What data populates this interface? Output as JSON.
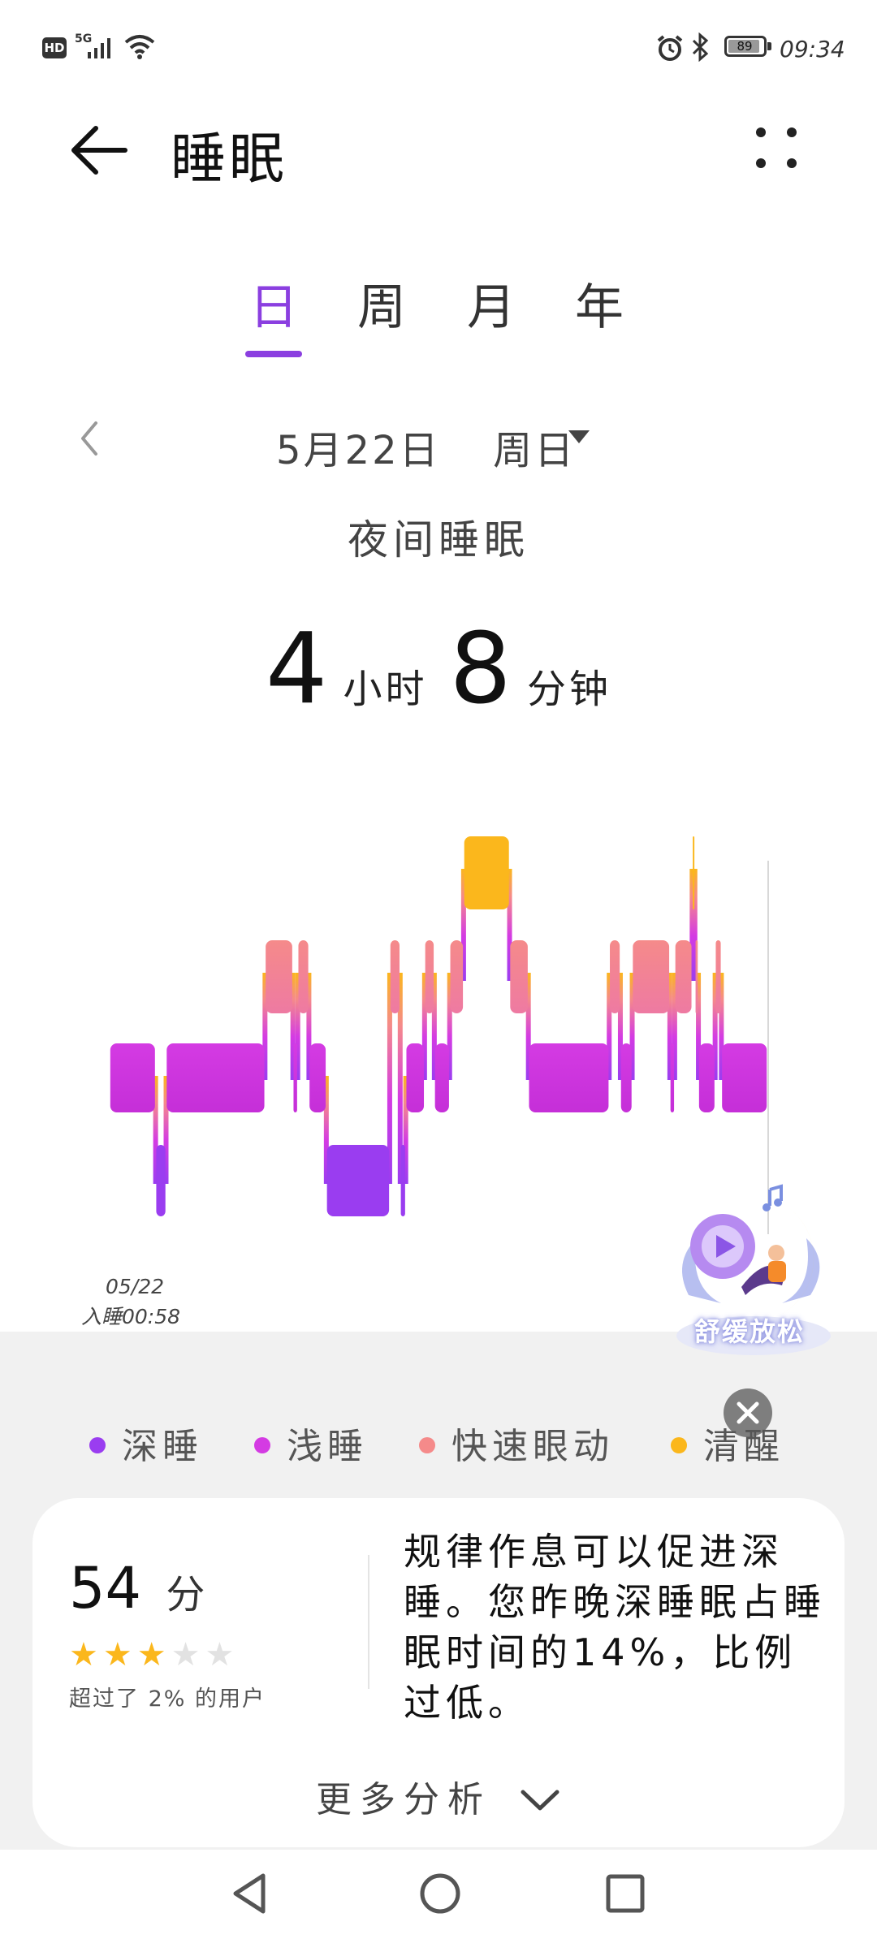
{
  "status_bar": {
    "network_label": "5G",
    "battery": "89",
    "time": "09:34",
    "icons": [
      "hd-icon",
      "signal-icon",
      "wifi-icon",
      "alarm-icon",
      "bluetooth-icon",
      "battery-icon"
    ]
  },
  "header": {
    "title": "睡眠",
    "back_icon": "back-arrow-icon",
    "more_icon": "more-dots-icon"
  },
  "tabs": [
    {
      "label": "日",
      "active": true
    },
    {
      "label": "周",
      "active": false
    },
    {
      "label": "月",
      "active": false
    },
    {
      "label": "年",
      "active": false
    }
  ],
  "date_selector": {
    "date": "5月22日",
    "weekday": "周日"
  },
  "sleep_summary": {
    "title": "夜间睡眠",
    "hours": "4",
    "hours_unit": "小时",
    "minutes": "8",
    "minutes_unit": "分钟"
  },
  "chart": {
    "start_date": "05/22",
    "start_label": "入睡00:58",
    "colors": {
      "deep": "#9a3df0",
      "light": "#d43be3",
      "rem": "#f58a8a",
      "awake": "#fbb71c"
    },
    "stages": [
      {
        "stage": "light",
        "w": 6.6
      },
      {
        "stage": "deep",
        "w": 1.5
      },
      {
        "stage": "light",
        "w": 14.2
      },
      {
        "stage": "rem",
        "w": 4.0
      },
      {
        "stage": "light",
        "w": 0.7
      },
      {
        "stage": "rem",
        "w": 1.6
      },
      {
        "stage": "light",
        "w": 2.5
      },
      {
        "stage": "deep",
        "w": 9.1
      },
      {
        "stage": "rem",
        "w": 1.5
      },
      {
        "stage": "deep",
        "w": 0.8
      },
      {
        "stage": "light",
        "w": 2.7
      },
      {
        "stage": "rem",
        "w": 1.4
      },
      {
        "stage": "light",
        "w": 2.2
      },
      {
        "stage": "rem",
        "w": 2.0
      },
      {
        "stage": "awake",
        "w": 6.6
      },
      {
        "stage": "rem",
        "w": 2.7
      },
      {
        "stage": "light",
        "w": 11.6
      },
      {
        "stage": "rem",
        "w": 1.6
      },
      {
        "stage": "light",
        "w": 1.7
      },
      {
        "stage": "rem",
        "w": 5.4
      },
      {
        "stage": "light",
        "w": 0.7
      },
      {
        "stage": "rem",
        "w": 2.5
      },
      {
        "stage": "awake",
        "w": 0.4
      },
      {
        "stage": "rem",
        "w": 0.5
      },
      {
        "stage": "light",
        "w": 2.4
      },
      {
        "stage": "rem",
        "w": 0.9
      },
      {
        "stage": "light",
        "w": 6.6
      }
    ]
  },
  "promo": {
    "text": "舒缓放松"
  },
  "legend": [
    {
      "label": "深睡",
      "color": "#9a3df0"
    },
    {
      "label": "浅睡",
      "color": "#d43be3"
    },
    {
      "label": "快速眼动",
      "color": "#f58a8a"
    },
    {
      "label": "清醒",
      "color": "#fbb71c"
    }
  ],
  "score_card": {
    "score": "54",
    "score_unit": "分",
    "stars_filled": 3,
    "stars_total": 5,
    "exceed_text": "超过了 2% 的用户",
    "advice": "规律作息可以促进深睡。您昨晚深睡眠占睡眠时间的14%，比例过低。",
    "more_label": "更多分析"
  }
}
